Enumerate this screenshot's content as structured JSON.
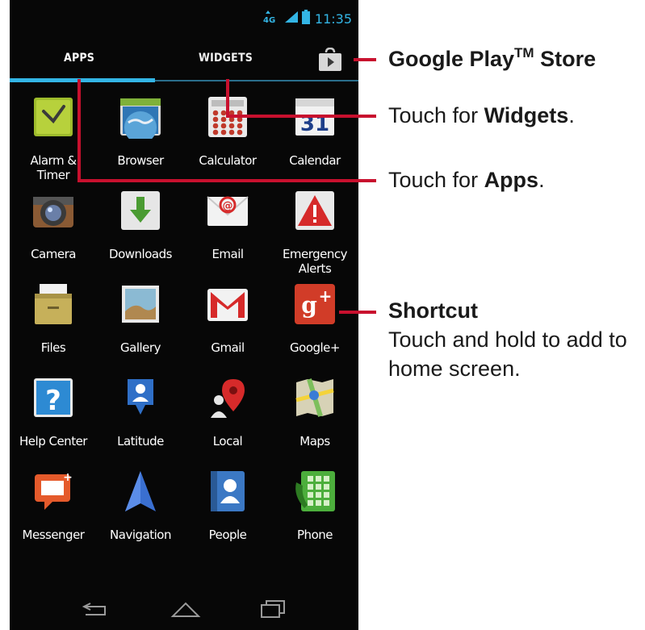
{
  "status_bar": {
    "network": "4G",
    "time": "11:35"
  },
  "tabs": {
    "apps": "APPS",
    "widgets": "WIDGETS",
    "store_icon": "google-play-store-icon"
  },
  "apps": [
    {
      "label": "Alarm &\nTimer",
      "icon": "alarm-clock-icon"
    },
    {
      "label": "Browser",
      "icon": "globe-icon"
    },
    {
      "label": "Calculator",
      "icon": "calculator-icon"
    },
    {
      "label": "Calendar",
      "icon": "calendar-icon",
      "icon_text": "31"
    },
    {
      "label": "Camera",
      "icon": "camera-icon"
    },
    {
      "label": "Downloads",
      "icon": "download-arrow-icon"
    },
    {
      "label": "Email",
      "icon": "envelope-icon"
    },
    {
      "label": "Emergency\nAlerts",
      "icon": "warning-triangle-icon"
    },
    {
      "label": "Files",
      "icon": "file-cabinet-icon"
    },
    {
      "label": "Gallery",
      "icon": "photo-icon"
    },
    {
      "label": "Gmail",
      "icon": "gmail-envelope-icon"
    },
    {
      "label": "Google+",
      "icon": "google-plus-icon",
      "icon_text": "g+"
    },
    {
      "label": "Help Center",
      "icon": "question-mark-icon",
      "icon_text": "?"
    },
    {
      "label": "Latitude",
      "icon": "latitude-pin-icon"
    },
    {
      "label": "Local",
      "icon": "map-pin-icon"
    },
    {
      "label": "Maps",
      "icon": "map-icon"
    },
    {
      "label": "Messenger",
      "icon": "chat-bubble-icon"
    },
    {
      "label": "Navigation",
      "icon": "navigation-arrow-icon"
    },
    {
      "label": "People",
      "icon": "contact-book-icon"
    },
    {
      "label": "Phone",
      "icon": "phone-keypad-icon"
    }
  ],
  "nav": {
    "back": "back-icon",
    "home": "home-icon",
    "recents": "recent-apps-icon"
  },
  "callouts": {
    "store": {
      "title": "Google Play",
      "tm": "TM",
      "title_end": " Store"
    },
    "widgets": {
      "prefix": "Touch for ",
      "bold": "Widgets",
      "suffix": "."
    },
    "apps": {
      "prefix": "Touch for ",
      "bold": "Apps",
      "suffix": "."
    },
    "shortcut": {
      "title": "Shortcut",
      "line1": "Touch and hold to add to",
      "line2": "home screen."
    }
  },
  "colors": {
    "accent_blue": "#33b5e5",
    "callout_red": "#c8102e"
  }
}
